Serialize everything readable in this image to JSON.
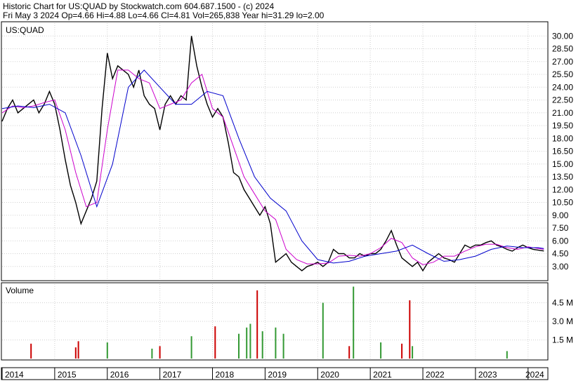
{
  "header": {
    "line1": "Historic Chart for US:QUAD by Stockwatch.com 604.687.1500 - (c) 2024",
    "line2": "Fri May  3 2024   Op=4.66  Hi=4.88  Lo=4.66  Cl=4.81  Vol=265,838  Year hi=31.29  lo=2.00"
  },
  "chart_data": [
    {
      "type": "line",
      "panel": "price",
      "title": "US:QUAD",
      "ylim": [
        1.5,
        31.5
      ],
      "y_ticks": [
        "30.00",
        "28.50",
        "27.00",
        "25.50",
        "24.00",
        "22.50",
        "21.00",
        "19.50",
        "18.00",
        "16.50",
        "15.00",
        "13.50",
        "12.00",
        "10.50",
        "9.00",
        "7.50",
        "6.00",
        "4.50",
        "3.00"
      ],
      "x_ticks": [
        "2014",
        "2015",
        "2016",
        "2017",
        "2018",
        "2019",
        "2020",
        "2021",
        "2022",
        "2023",
        "2024"
      ],
      "x_range": [
        2014.0,
        2024.35
      ],
      "series": [
        {
          "name": "",
          "color": "#000000",
          "x": [
            2014.0,
            2014.1,
            2014.2,
            2014.3,
            2014.4,
            2014.5,
            2014.6,
            2014.7,
            2014.8,
            2014.9,
            2015.0,
            2015.1,
            2015.2,
            2015.3,
            2015.4,
            2015.5,
            2015.6,
            2015.7,
            2015.8,
            2015.9,
            2016.0,
            2016.1,
            2016.2,
            2016.3,
            2016.4,
            2016.5,
            2016.6,
            2016.7,
            2016.8,
            2016.9,
            2017.0,
            2017.1,
            2017.2,
            2017.3,
            2017.4,
            2017.5,
            2017.6,
            2017.7,
            2017.8,
            2017.9,
            2018.0,
            2018.1,
            2018.2,
            2018.3,
            2018.4,
            2018.5,
            2018.6,
            2018.7,
            2018.8,
            2018.9,
            2019.0,
            2019.1,
            2019.2,
            2019.3,
            2019.4,
            2019.5,
            2019.6,
            2019.7,
            2019.8,
            2019.9,
            2020.0,
            2020.1,
            2020.2,
            2020.3,
            2020.4,
            2020.5,
            2020.6,
            2020.7,
            2020.8,
            2020.9,
            2021.0,
            2021.1,
            2021.2,
            2021.3,
            2021.4,
            2021.5,
            2021.6,
            2021.7,
            2021.8,
            2021.9,
            2022.0,
            2022.1,
            2022.2,
            2022.3,
            2022.4,
            2022.5,
            2022.6,
            2022.7,
            2022.8,
            2022.9,
            2023.0,
            2023.1,
            2023.2,
            2023.3,
            2023.4,
            2023.5,
            2023.6,
            2023.7,
            2023.8,
            2023.9,
            2024.0,
            2024.1,
            2024.2,
            2024.3
          ],
          "values": [
            20.0,
            21.5,
            22.5,
            21.0,
            21.5,
            22.0,
            22.5,
            21.0,
            22.0,
            23.5,
            22.0,
            19.0,
            15.5,
            12.5,
            10.5,
            8.0,
            9.5,
            11.0,
            13.0,
            21.5,
            28.0,
            25.0,
            26.5,
            26.0,
            25.5,
            24.0,
            26.0,
            23.0,
            22.0,
            21.5,
            19.0,
            22.0,
            23.0,
            22.0,
            23.0,
            22.5,
            30.0,
            26.5,
            24.0,
            22.0,
            20.5,
            21.5,
            20.5,
            17.5,
            14.0,
            13.5,
            12.0,
            11.0,
            10.0,
            9.0,
            10.0,
            8.0,
            3.5,
            4.0,
            4.5,
            3.5,
            3.0,
            2.5,
            3.0,
            3.2,
            3.5,
            3.0,
            3.5,
            5.0,
            4.5,
            4.5,
            4.0,
            4.0,
            4.5,
            4.2,
            4.5,
            4.5,
            5.0,
            6.0,
            7.2,
            5.5,
            4.0,
            3.5,
            3.0,
            3.5,
            2.5,
            3.5,
            4.0,
            4.5,
            4.0,
            3.8,
            3.5,
            4.5,
            5.5,
            5.2,
            5.5,
            5.5,
            5.8,
            6.0,
            5.5,
            5.3,
            5.0,
            4.8,
            5.2,
            5.5,
            5.2,
            5.0,
            4.9,
            4.81
          ]
        },
        {
          "name": "",
          "color": "#cc00cc",
          "x": [
            2014.0,
            2014.2,
            2014.4,
            2014.6,
            2014.8,
            2015.0,
            2015.2,
            2015.4,
            2015.6,
            2015.8,
            2016.0,
            2016.2,
            2016.4,
            2016.6,
            2016.8,
            2017.0,
            2017.2,
            2017.4,
            2017.6,
            2017.8,
            2018.0,
            2018.2,
            2018.4,
            2018.6,
            2018.8,
            2019.0,
            2019.2,
            2019.4,
            2019.6,
            2019.8,
            2020.0,
            2020.2,
            2020.4,
            2020.6,
            2020.8,
            2021.0,
            2021.2,
            2021.4,
            2021.6,
            2021.8,
            2022.0,
            2022.2,
            2022.4,
            2022.6,
            2022.8,
            2023.0,
            2023.2,
            2023.4,
            2023.6,
            2023.8,
            2024.0,
            2024.3
          ],
          "values": [
            21.0,
            21.8,
            21.6,
            21.8,
            22.2,
            22.5,
            19.0,
            14.0,
            10.0,
            10.5,
            19.0,
            26.0,
            26.0,
            25.0,
            24.5,
            21.5,
            22.0,
            22.5,
            24.5,
            25.5,
            21.5,
            20.5,
            17.0,
            13.5,
            11.5,
            9.5,
            8.5,
            5.0,
            3.8,
            3.3,
            3.3,
            3.4,
            4.2,
            4.3,
            4.2,
            4.5,
            5.2,
            6.3,
            5.8,
            4.0,
            3.2,
            3.5,
            4.2,
            4.2,
            4.8,
            5.3,
            5.6,
            5.6,
            5.2,
            5.0,
            5.3,
            5.0
          ]
        },
        {
          "name": "",
          "color": "#0000cc",
          "x": [
            2014.0,
            2014.3,
            2014.6,
            2014.9,
            2015.2,
            2015.5,
            2015.8,
            2016.1,
            2016.4,
            2016.7,
            2017.0,
            2017.3,
            2017.6,
            2017.9,
            2018.2,
            2018.5,
            2018.8,
            2019.1,
            2019.4,
            2019.7,
            2020.0,
            2020.3,
            2020.6,
            2020.9,
            2021.2,
            2021.5,
            2021.8,
            2022.1,
            2022.4,
            2022.7,
            2023.0,
            2023.3,
            2023.6,
            2023.9,
            2024.2,
            2024.3
          ],
          "values": [
            21.5,
            21.8,
            21.6,
            22.0,
            21.0,
            16.0,
            10.0,
            15.0,
            24.0,
            26.0,
            24.0,
            22.0,
            22.0,
            23.5,
            23.0,
            18.0,
            13.5,
            11.0,
            9.5,
            6.0,
            3.8,
            3.4,
            3.6,
            4.2,
            4.5,
            4.8,
            5.5,
            4.5,
            3.6,
            3.8,
            4.2,
            5.0,
            5.4,
            5.2,
            5.2,
            5.1
          ]
        }
      ]
    },
    {
      "type": "bar",
      "panel": "volume",
      "title": "Volume",
      "ylim": [
        0,
        6000000
      ],
      "y_ticks": [
        "4.5 M",
        "3.0 M",
        "1.5 M"
      ],
      "y_tick_values": [
        4500000,
        3000000,
        1500000
      ],
      "bars": [
        {
          "x": 2014.55,
          "value": 1200000,
          "color": "#cc0000"
        },
        {
          "x": 2015.4,
          "value": 900000,
          "color": "#cc0000"
        },
        {
          "x": 2015.45,
          "value": 1400000,
          "color": "#cc0000"
        },
        {
          "x": 2016.0,
          "value": 1300000,
          "color": "#339933"
        },
        {
          "x": 2016.85,
          "value": 800000,
          "color": "#339933"
        },
        {
          "x": 2017.0,
          "value": 1000000,
          "color": "#cc0000"
        },
        {
          "x": 2017.6,
          "value": 1800000,
          "color": "#339933"
        },
        {
          "x": 2018.05,
          "value": 2600000,
          "color": "#cc0000"
        },
        {
          "x": 2018.5,
          "value": 2000000,
          "color": "#339933"
        },
        {
          "x": 2018.65,
          "value": 2500000,
          "color": "#339933"
        },
        {
          "x": 2018.72,
          "value": 2800000,
          "color": "#339933"
        },
        {
          "x": 2018.85,
          "value": 5500000,
          "color": "#cc0000"
        },
        {
          "x": 2018.95,
          "value": 2200000,
          "color": "#339933"
        },
        {
          "x": 2019.2,
          "value": 2500000,
          "color": "#339933"
        },
        {
          "x": 2019.35,
          "value": 2000000,
          "color": "#339933"
        },
        {
          "x": 2020.1,
          "value": 4500000,
          "color": "#339933"
        },
        {
          "x": 2020.6,
          "value": 1000000,
          "color": "#cc0000"
        },
        {
          "x": 2020.68,
          "value": 5800000,
          "color": "#339933"
        },
        {
          "x": 2021.2,
          "value": 1300000,
          "color": "#339933"
        },
        {
          "x": 2021.6,
          "value": 1200000,
          "color": "#cc0000"
        },
        {
          "x": 2021.75,
          "value": 4700000,
          "color": "#cc0000"
        },
        {
          "x": 2021.8,
          "value": 1000000,
          "color": "#339933"
        },
        {
          "x": 2023.6,
          "value": 600000,
          "color": "#339933"
        }
      ]
    }
  ]
}
